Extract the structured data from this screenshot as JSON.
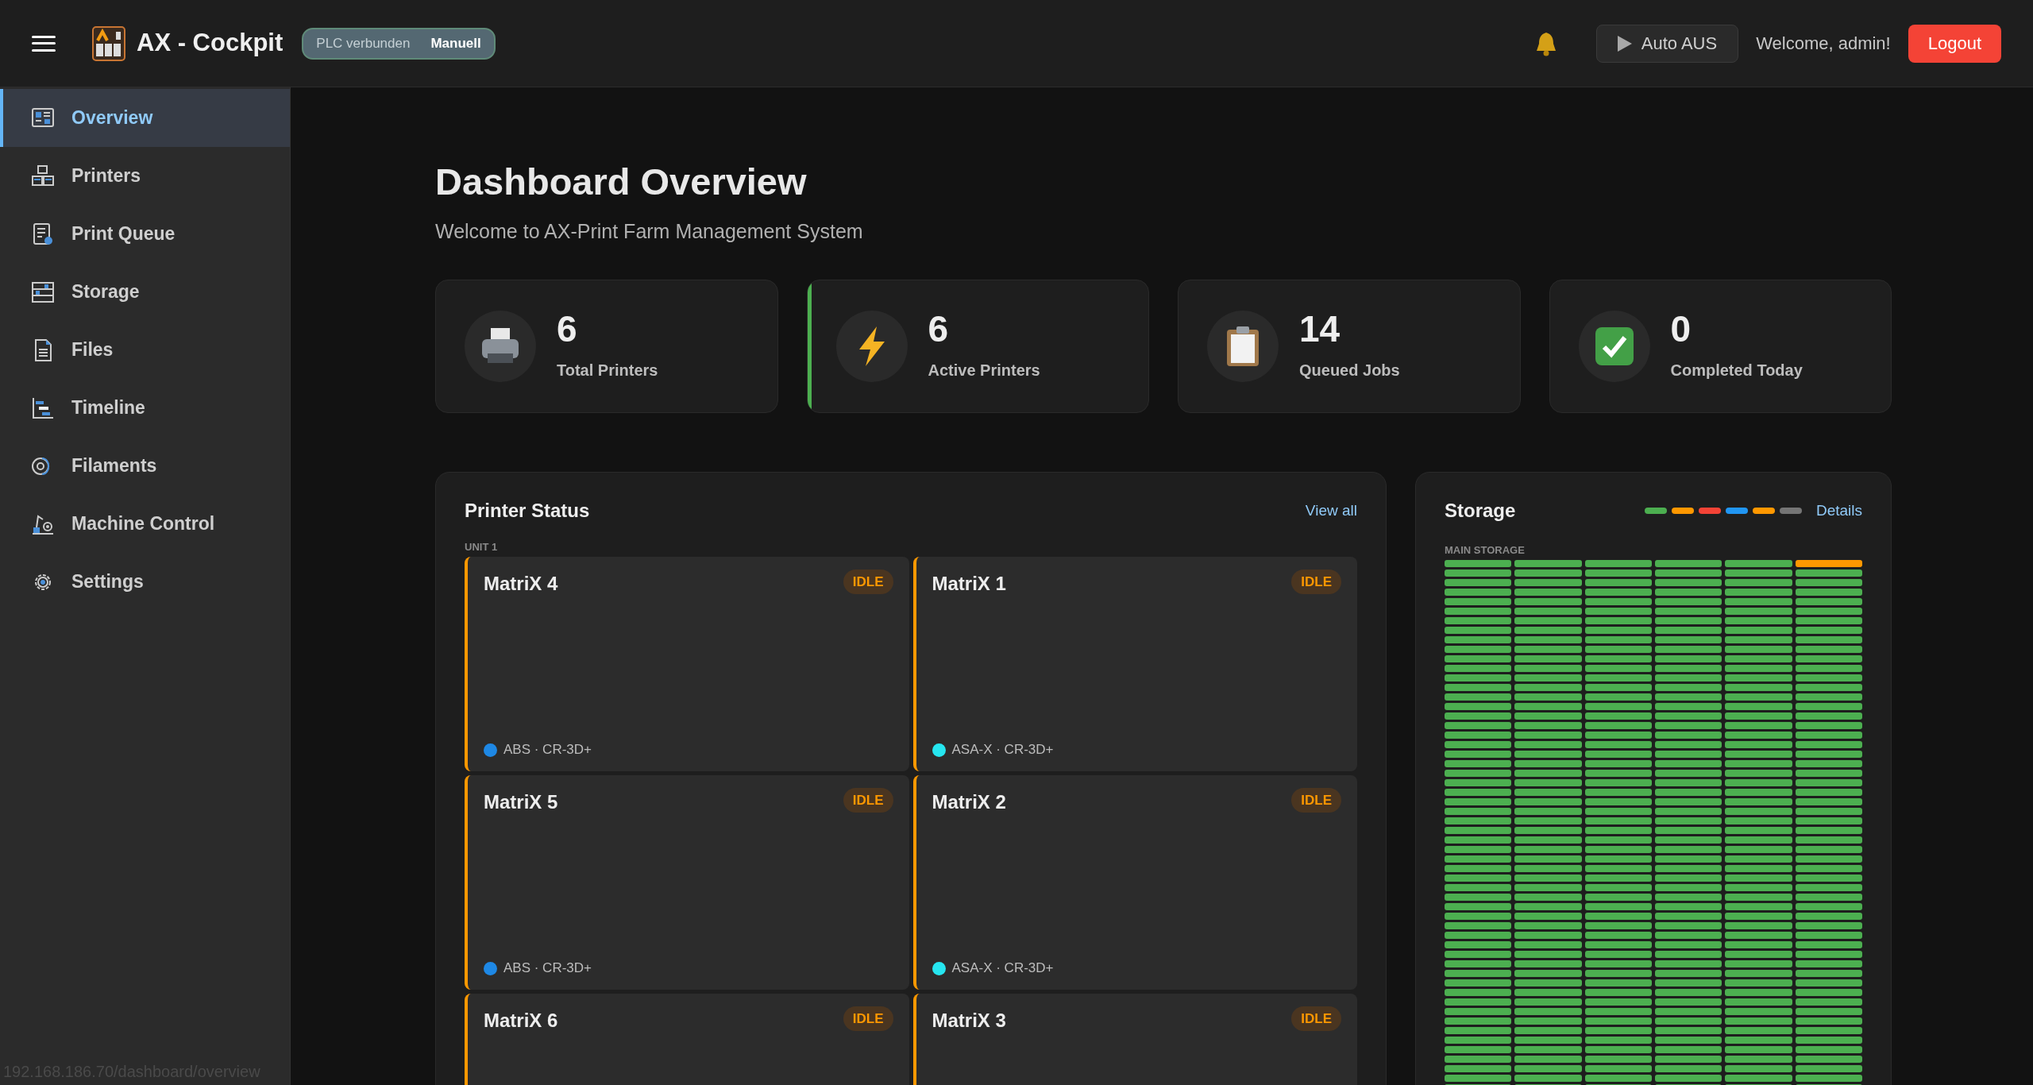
{
  "header": {
    "title": "AX - Cockpit",
    "plc": {
      "status": "PLC verbunden",
      "mode": "Manuell"
    },
    "auto_button": "Auto AUS",
    "welcome": "Welcome, admin!",
    "logout": "Logout"
  },
  "sidebar": {
    "items": [
      {
        "label": "Overview",
        "kind": "overview",
        "selected": true
      },
      {
        "label": "Printers",
        "kind": "printers",
        "selected": false
      },
      {
        "label": "Print Queue",
        "kind": "queue",
        "selected": false
      },
      {
        "label": "Storage",
        "kind": "storage",
        "selected": false
      },
      {
        "label": "Files",
        "kind": "files",
        "selected": false
      },
      {
        "label": "Timeline",
        "kind": "timeline",
        "selected": false
      },
      {
        "label": "Filaments",
        "kind": "filaments",
        "selected": false
      },
      {
        "label": "Machine Control",
        "kind": "machine",
        "selected": false
      },
      {
        "label": "Settings",
        "kind": "settings",
        "selected": false
      }
    ]
  },
  "page": {
    "title": "Dashboard Overview",
    "subtitle": "Welcome to AX-Print Farm Management System"
  },
  "stats": [
    {
      "value": "6",
      "label": "Total Printers",
      "kind": "printer",
      "highlighted": false
    },
    {
      "value": "6",
      "label": "Active Printers",
      "kind": "bolt",
      "highlighted": true
    },
    {
      "value": "14",
      "label": "Queued Jobs",
      "kind": "clipboard",
      "highlighted": false
    },
    {
      "value": "0",
      "label": "Completed Today",
      "kind": "check",
      "highlighted": false
    }
  ],
  "printer_status": {
    "title": "Printer Status",
    "link": "View all",
    "unit": "UNIT 1",
    "printers": [
      {
        "name": "MatriX 4",
        "status": "IDLE",
        "filament": {
          "text": "ABS · CR-3D+",
          "color": "#1e88e5"
        }
      },
      {
        "name": "MatriX 1",
        "status": "IDLE",
        "filament": {
          "text": "ASA-X · CR-3D+",
          "color": "#26e6f0"
        }
      },
      {
        "name": "MatriX 5",
        "status": "IDLE",
        "filament": {
          "text": "ABS · CR-3D+",
          "color": "#1e88e5"
        }
      },
      {
        "name": "MatriX 2",
        "status": "IDLE",
        "filament": {
          "text": "ASA-X · CR-3D+",
          "color": "#26e6f0"
        }
      },
      {
        "name": "MatriX 6",
        "status": "IDLE"
      },
      {
        "name": "MatriX 3",
        "status": "IDLE"
      }
    ]
  },
  "storage": {
    "title": "Storage",
    "link": "Details",
    "legend": [
      {
        "color": "#4caf50"
      },
      {
        "color": "#ff9800"
      },
      {
        "color": "#f44336"
      },
      {
        "color": "#2196f3"
      },
      {
        "color": "#ff9800"
      },
      {
        "color": "#757575"
      }
    ],
    "section": "MAIN STORAGE",
    "first_row": [
      {
        "color": "#4caf50"
      },
      {
        "color": "#4caf50"
      },
      {
        "color": "#4caf50"
      },
      {
        "color": "#4caf50"
      },
      {
        "color": "#4caf50"
      },
      {
        "color": "#ff9800"
      }
    ],
    "other_rows": {
      "color": "#4caf50"
    }
  },
  "status_url": "192.168.186.70/dashboard/overview"
}
